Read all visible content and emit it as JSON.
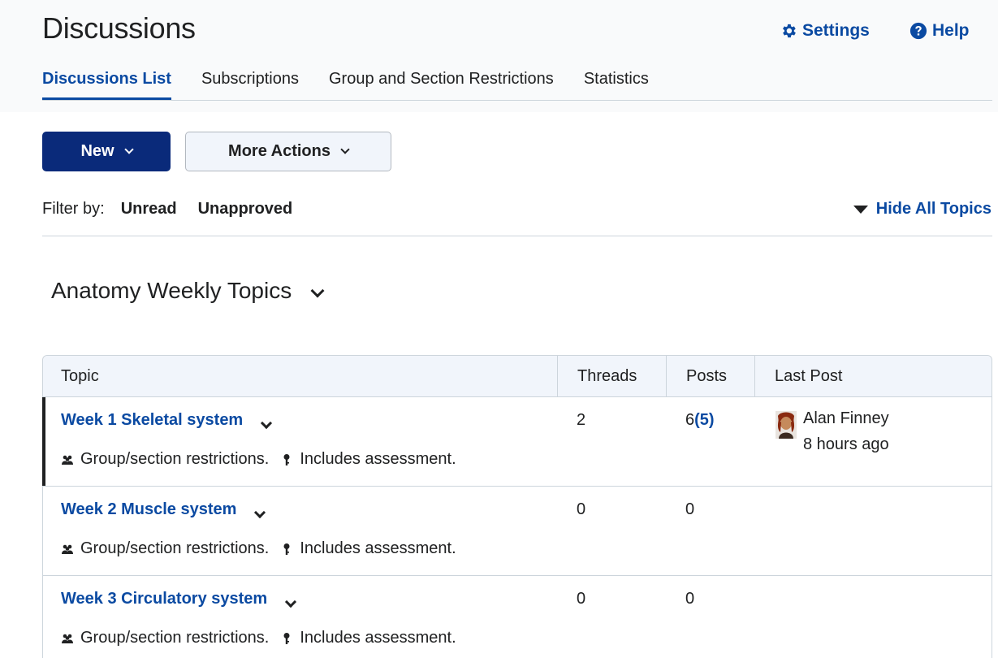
{
  "header": {
    "title": "Discussions",
    "settings_label": "Settings",
    "help_label": "Help",
    "settings_icon": "gear-icon",
    "help_icon": "question-circle-icon"
  },
  "tabs": [
    {
      "label": "Discussions List",
      "active": true
    },
    {
      "label": "Subscriptions",
      "active": false
    },
    {
      "label": "Group and Section Restrictions",
      "active": false
    },
    {
      "label": "Statistics",
      "active": false
    }
  ],
  "toolbar": {
    "new_label": "New",
    "more_label": "More Actions"
  },
  "filter": {
    "label": "Filter by:",
    "options": [
      "Unread",
      "Unapproved"
    ],
    "hide_all_label": "Hide All Topics"
  },
  "forum": {
    "title": "Anatomy Weekly Topics",
    "columns": {
      "topic": "Topic",
      "threads": "Threads",
      "posts": "Posts",
      "last_post": "Last Post"
    },
    "topics": [
      {
        "title": "Week 1 Skeletal system",
        "restrictions": "Group/section restrictions.",
        "assessment": "Includes assessment.",
        "threads": "2",
        "posts": "6",
        "posts_unread": "(5)",
        "last_post_author": "Alan Finney",
        "last_post_time": "8 hours ago"
      },
      {
        "title": "Week 2 Muscle system",
        "restrictions": "Group/section restrictions.",
        "assessment": "Includes assessment.",
        "threads": "0",
        "posts": "0"
      },
      {
        "title": "Week 3 Circulatory system",
        "restrictions": "Group/section restrictions.",
        "assessment": "Includes assessment.",
        "threads": "0",
        "posts": "0"
      }
    ]
  },
  "colors": {
    "link": "#0b4aa2",
    "primary_button": "#0a2a7a",
    "border": "#cdd5dc",
    "header_bg": "#f1f5fb"
  }
}
